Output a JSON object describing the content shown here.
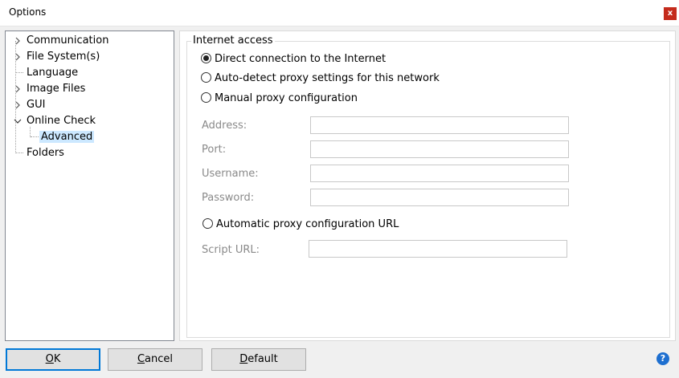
{
  "window": {
    "title": "Options",
    "close_glyph": "x"
  },
  "tree": {
    "items": [
      {
        "label": "Communication",
        "expanded": false
      },
      {
        "label": "File System(s)",
        "expanded": false
      },
      {
        "label": "Language"
      },
      {
        "label": "Image Files",
        "expanded": false
      },
      {
        "label": "GUI",
        "expanded": false
      },
      {
        "label": "Online Check",
        "expanded": true
      },
      {
        "label": "Advanced",
        "selected": true
      },
      {
        "label": "Folders"
      }
    ]
  },
  "internet_access": {
    "group_label": "Internet access",
    "options": [
      {
        "label": "Direct connection to the Internet",
        "checked": true
      },
      {
        "label": "Auto-detect proxy settings for this network",
        "checked": false
      },
      {
        "label": "Manual proxy configuration",
        "checked": false
      }
    ],
    "fields": [
      {
        "label": "Address:",
        "value": ""
      },
      {
        "label": "Port:",
        "value": ""
      },
      {
        "label": "Username:",
        "value": ""
      },
      {
        "label": "Password:",
        "value": ""
      }
    ],
    "auto_url_option": {
      "label": "Automatic proxy configuration URL",
      "checked": false
    },
    "script_url": {
      "label": "Script URL:",
      "value": ""
    }
  },
  "buttons": {
    "ok": {
      "prefix": "",
      "accel": "O",
      "rest": "K"
    },
    "cancel": {
      "prefix": "",
      "accel": "C",
      "rest": "ancel"
    },
    "default": {
      "prefix": "",
      "accel": "D",
      "rest": "efault"
    }
  },
  "help": {
    "glyph": "?"
  }
}
